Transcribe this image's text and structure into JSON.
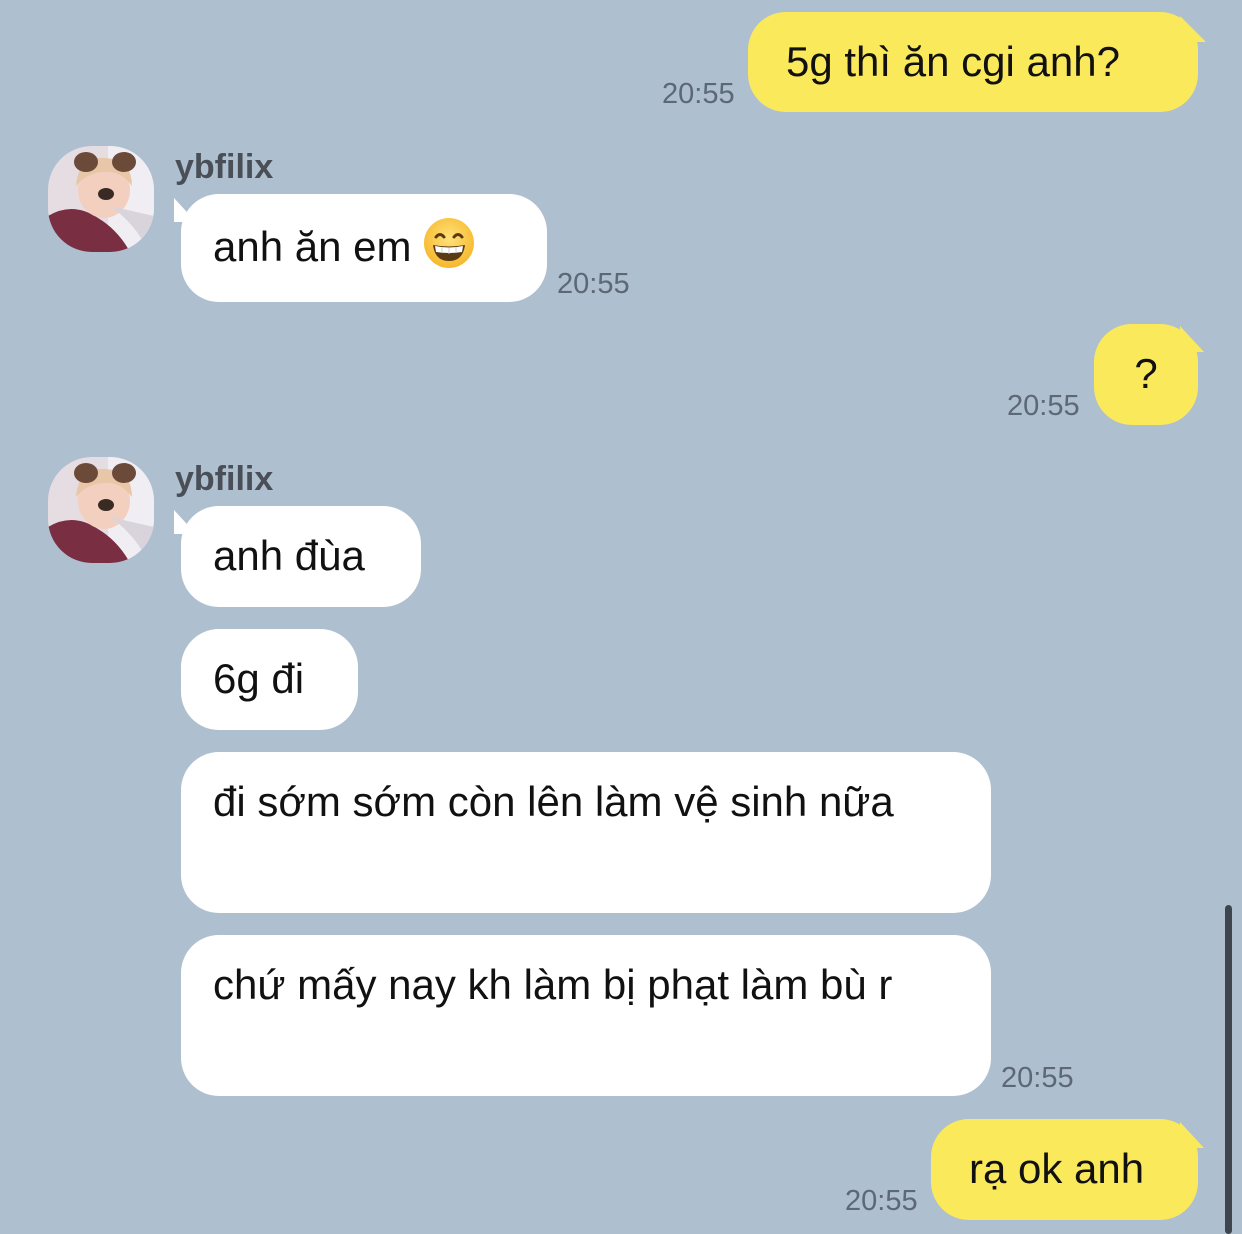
{
  "chat": {
    "messages": [
      {
        "direction": "out",
        "text": "5g thì ăn cgi anh?",
        "time": "20:55"
      },
      {
        "direction": "in",
        "sender": "ybfilix",
        "text": "anh ăn em",
        "emoji": "grinning-face-icon",
        "time": "20:55"
      },
      {
        "direction": "out",
        "text": "?",
        "time": "20:55"
      },
      {
        "direction": "in",
        "sender": "ybfilix",
        "text": "anh đùa"
      },
      {
        "direction": "in",
        "text": "6g đi"
      },
      {
        "direction": "in",
        "text": "đi sớm sớm còn lên làm vệ sinh nữa"
      },
      {
        "direction": "in",
        "text": "chứ mấy nay kh làm bị phạt làm bù r",
        "time": "20:55"
      },
      {
        "direction": "out",
        "text": "rạ ok anh",
        "time": "20:55"
      }
    ]
  },
  "colors": {
    "background": "#aebfd0",
    "outgoing_bubble": "#fbe95c",
    "incoming_bubble": "#ffffff",
    "timestamp": "#5d6875",
    "sender_name": "#4a4f57"
  }
}
